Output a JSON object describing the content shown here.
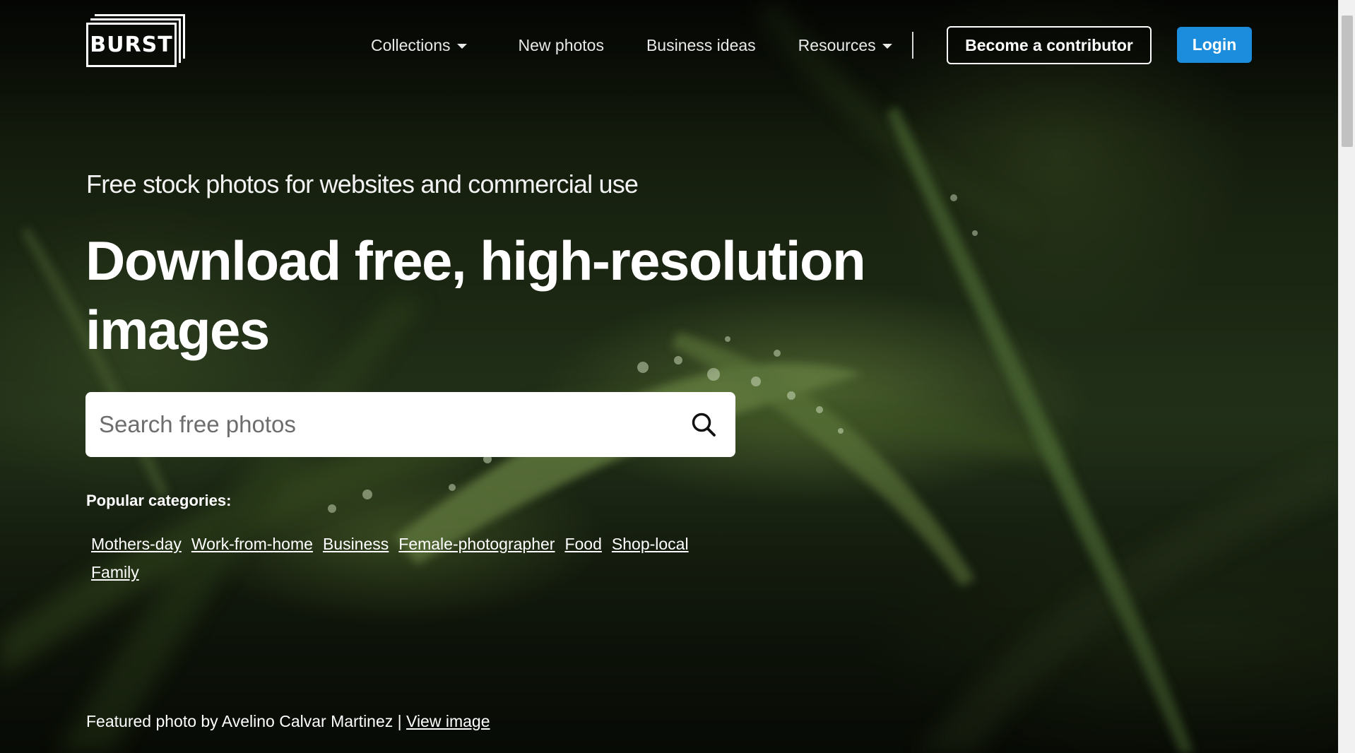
{
  "header": {
    "logo_text": "BURST",
    "nav": {
      "collections": "Collections",
      "new_photos": "New photos",
      "business_ideas": "Business ideas",
      "resources": "Resources"
    },
    "contributor_label": "Become a contributor",
    "login_label": "Login"
  },
  "hero": {
    "subtitle": "Free stock photos for websites and commercial use",
    "headline": "Download free, high-resolution images"
  },
  "search": {
    "placeholder": "Search free photos"
  },
  "popular": {
    "label": "Popular categories:",
    "categories": [
      "Mothers-day",
      "Work-from-home",
      "Business",
      "Female-photographer",
      "Food",
      "Shop-local",
      "Family"
    ]
  },
  "featured": {
    "text": "Featured photo by Avelino Calvar Martinez |",
    "link": "View image"
  },
  "colors": {
    "login_button": "#1c8ddc",
    "background": "#1b2612"
  },
  "icons": {
    "search": "search-icon",
    "caret": "chevron-down-icon"
  }
}
